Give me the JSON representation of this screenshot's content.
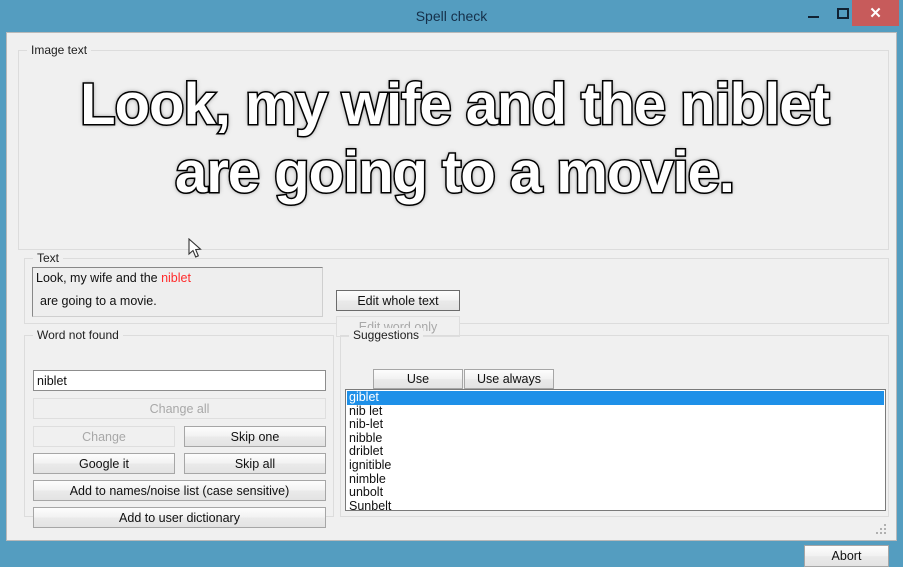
{
  "window": {
    "title": "Spell check",
    "frame_color": "#549dc0",
    "client_bg": "#f0f0f0",
    "controls": {
      "minimize": "minimize-icon",
      "maximize": "maximize-icon",
      "close": "close-icon",
      "close_color": "#c75b5b"
    }
  },
  "image_text": {
    "group_label": "Image text",
    "line1": "Look, my wife and the niblet",
    "line2": "are going to a movie.",
    "fill_color": "#ffffff",
    "outline_color": "#000000"
  },
  "text_section": {
    "group_label": "Text",
    "line1_before": "Look, my wife and the ",
    "line1_misspelled": "niblet",
    "line2": "are going to a movie.",
    "misspelled_color": "#ff2b2b",
    "buttons": {
      "edit_whole_text": "Edit whole text",
      "edit_word_only": "Edit word only"
    }
  },
  "word_not_found": {
    "group_label": "Word not found",
    "input_value": "niblet",
    "input_placeholder": "",
    "buttons": {
      "change_all": "Change all",
      "change": "Change",
      "skip_one": "Skip one",
      "google_it": "Google it",
      "skip_all": "Skip all",
      "add_to_names": "Add to names/noise list (case sensitive)",
      "add_to_dictionary": "Add to user dictionary"
    }
  },
  "suggestions": {
    "group_label": "Suggestions",
    "buttons": {
      "use": "Use",
      "use_always": "Use always"
    },
    "selected_index": 0,
    "selection_color": "#1e90e8",
    "items": [
      "giblet",
      "nib let",
      "nib-let",
      "nibble",
      "driblet",
      "ignitible",
      "nimble",
      "unbolt",
      "Sunbelt"
    ]
  },
  "footer": {
    "abort": "Abort",
    "grip": "resize-grip-icon"
  }
}
